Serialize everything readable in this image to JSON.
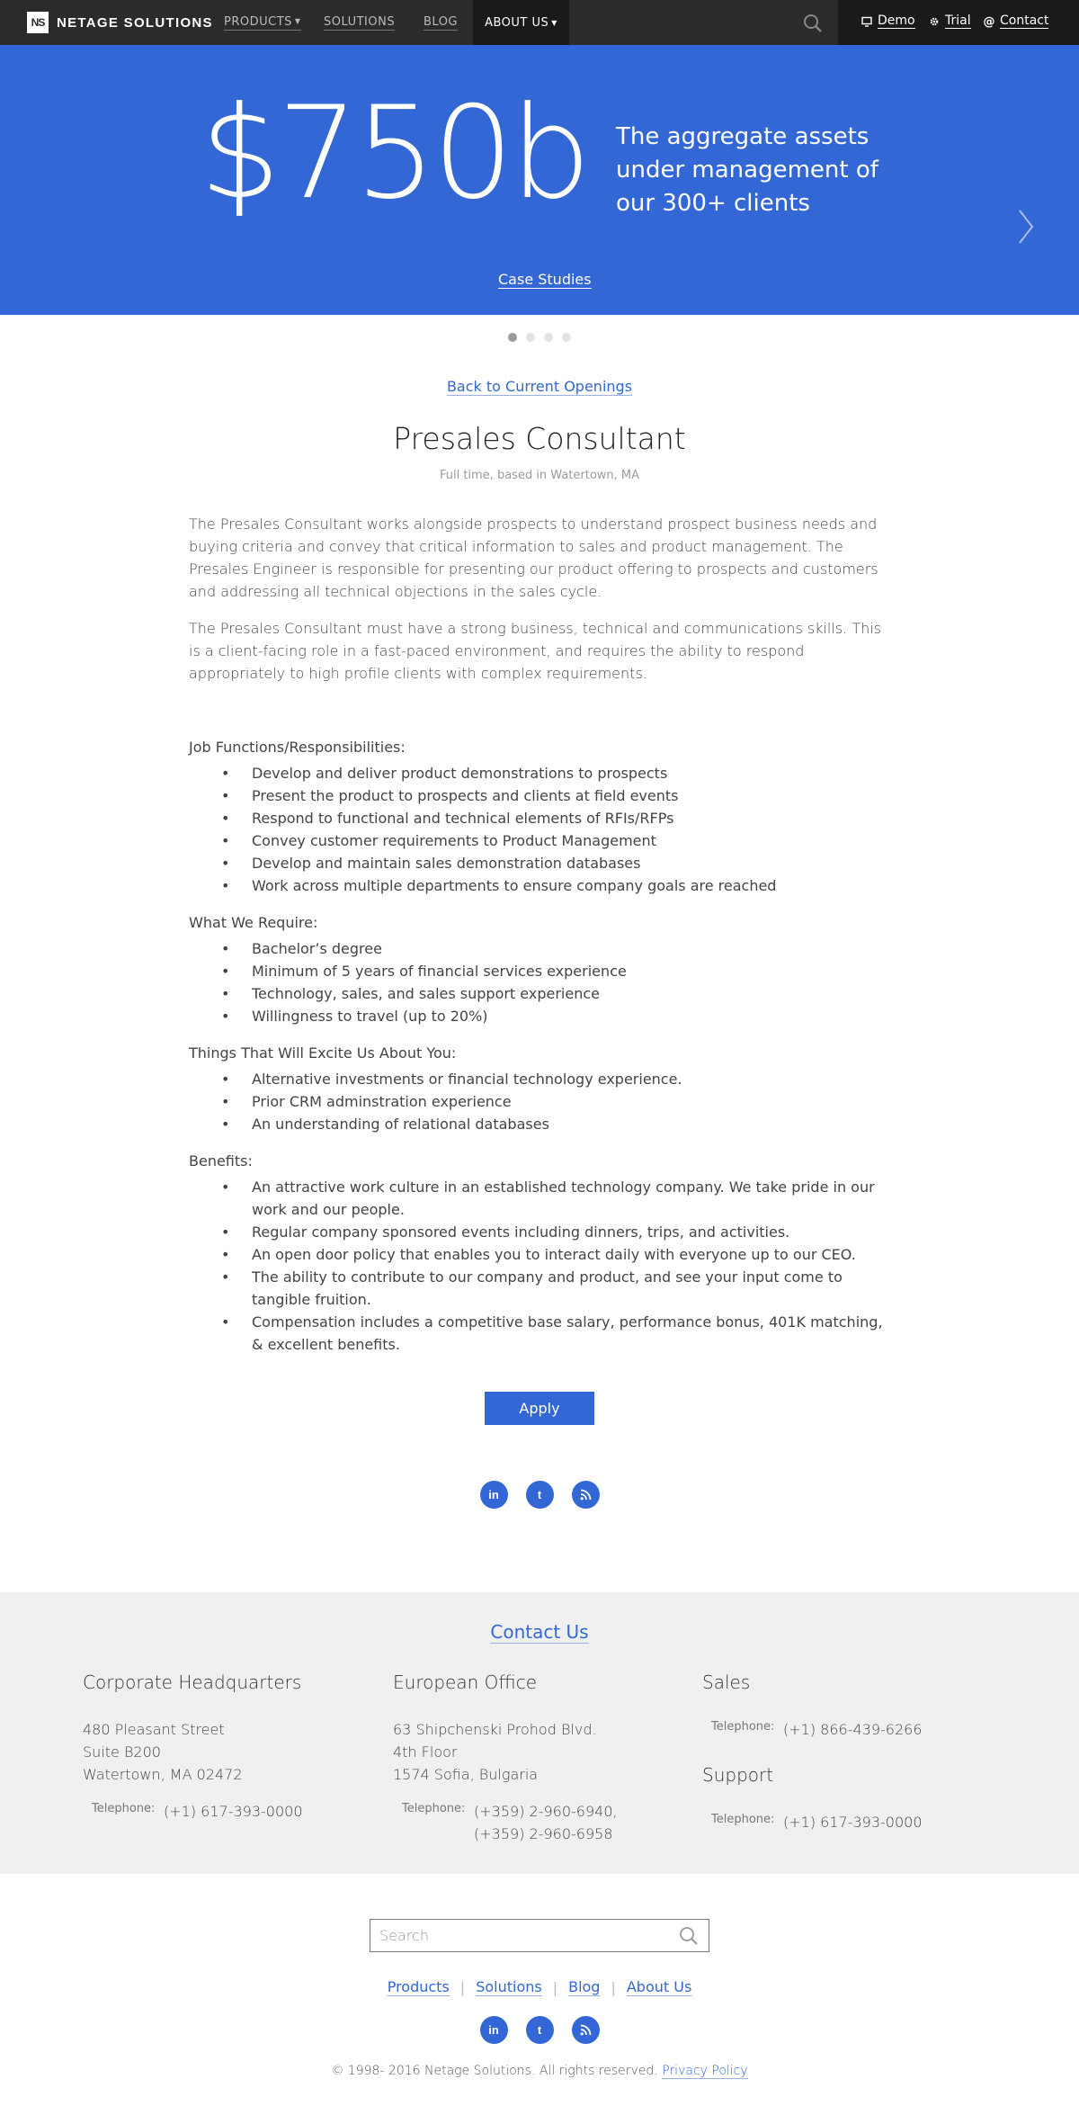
{
  "nav": {
    "logo_mark": "NS",
    "logo_text": "NETAGE SOLUTIONS",
    "items": [
      {
        "label": "PRODUCTS"
      },
      {
        "label": "SOLUTIONS"
      },
      {
        "label": "BLOG"
      },
      {
        "label": "ABOUT US"
      }
    ],
    "util": [
      {
        "label": "Demo",
        "icon": "monitor-icon"
      },
      {
        "label": "Trial",
        "icon": "gear-icon"
      },
      {
        "label": "Contact",
        "icon": "at-icon"
      }
    ]
  },
  "hero": {
    "big": "$750b",
    "desc": "The aggregate assets under management of our 300+ clients",
    "link": "Case Studies",
    "slides": 4,
    "active_slide": 1
  },
  "job": {
    "back": "Back to Current Openings",
    "title": "Presales Consultant",
    "subtitle": "Full time, based in Watertown, MA",
    "para1": "The Presales Consultant works alongside prospects to understand prospect business needs and buying criteria and convey that critical information to sales and product management. The Presales Engineer is responsible for presenting our product offering to prospects and customers and addressing all technical objections in the sales cycle.",
    "para2": "The Presales Consultant must have a strong business, technical and communications skills. This is a client-facing role in a fast-paced environment, and requires the ability to respond appropriately to high profile clients with complex requirements.",
    "sections": [
      {
        "heading": "Job Functions/Responsibilities:",
        "items": [
          "Develop and deliver product demonstrations to prospects",
          "Present the product to prospects and clients at field events",
          "Respond to functional and technical elements of RFIs/RFPs",
          "Convey customer requirements to Product Management",
          "Develop and maintain sales demonstration databases",
          "Work across multiple departments to ensure company goals are reached"
        ]
      },
      {
        "heading": "What We Require:",
        "items": [
          "Bachelor’s degree",
          "Minimum of 5 years of financial services experience",
          "Technology, sales, and sales support experience",
          "Willingness to travel (up to 20%)"
        ]
      },
      {
        "heading": "Things That Will Excite Us About You:",
        "items": [
          "Alternative investments or financial technology experience.",
          "Prior CRM adminstration experience",
          "An understanding of relational databases"
        ]
      },
      {
        "heading": "Benefits:",
        "items": [
          "An attractive work culture in an established technology company. We take pride in our work and our people.",
          "Regular company sponsored events including dinners, trips, and activities.",
          "An open door policy that enables you to interact daily with everyone up to our CEO.",
          "The ability to contribute to our company and product, and see your input come to tangible fruition.",
          "Compensation includes a competitive base salary, performance bonus, 401K matching, & excellent benefits."
        ]
      }
    ],
    "apply": "Apply"
  },
  "social": [
    {
      "label": "in",
      "icon": "linkedin-icon"
    },
    {
      "label": "t",
      "icon": "tumblr-icon"
    },
    {
      "label": "rss",
      "icon": "rss-icon"
    }
  ],
  "contact": {
    "title": "Contact Us",
    "hq": {
      "heading": "Corporate Headquarters",
      "line1": "480 Pleasant Street",
      "line2": "Suite B200",
      "line3": "Watertown, MA 02472",
      "tel_label": "Telephone:",
      "tel": "(+1) 617-393-0000"
    },
    "eu": {
      "heading": "European Office",
      "line1": "63 Shipchenski Prohod Blvd.",
      "line2": "4th Floor",
      "line3": "1574 Sofia, Bulgaria",
      "tel_label": "Telephone:",
      "tel1": "(+359) 2-960-6940,",
      "tel2": "(+359) 2-960-6958"
    },
    "sales": {
      "heading": "Sales",
      "tel_label": "Telephone:",
      "tel": "(+1) 866-439-6266"
    },
    "support": {
      "heading": "Support",
      "tel_label": "Telephone:",
      "tel": "(+1) 617-393-0000"
    }
  },
  "footer": {
    "search_placeholder": "Search",
    "links": [
      "Products",
      "Solutions",
      "Blog",
      "About Us"
    ],
    "copyright": "© 1998- 2016 Netage Solutions. All rights reserved.",
    "privacy": "Privacy Policy"
  },
  "colors": {
    "brand_blue": "#3367d6",
    "nav_bg": "#2b2b2b",
    "contact_bg": "#f0f0f0"
  }
}
